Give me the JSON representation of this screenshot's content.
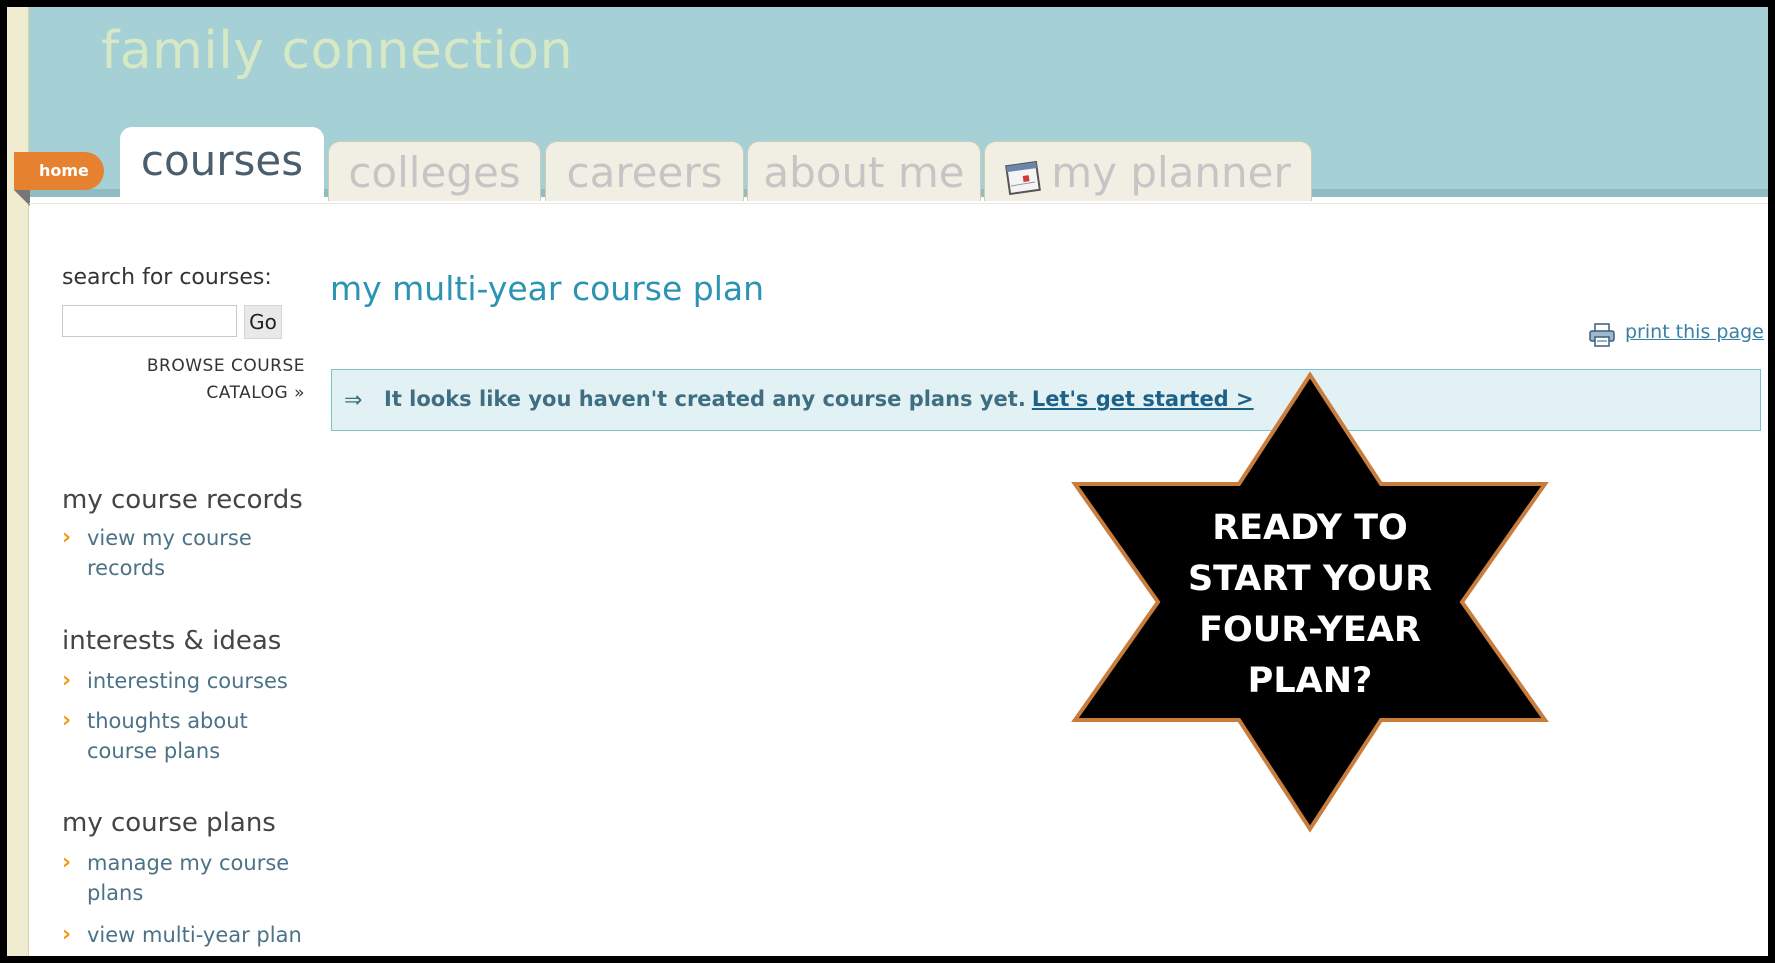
{
  "header": {
    "logo_text": "family connection",
    "home_label": "home",
    "tabs": [
      {
        "label": "courses",
        "active": true
      },
      {
        "label": "colleges",
        "active": false
      },
      {
        "label": "careers",
        "active": false
      },
      {
        "label": "about me",
        "active": false
      },
      {
        "label": "my planner",
        "active": false,
        "icon": "calendar-icon"
      }
    ]
  },
  "sidebar": {
    "search_label": "search for courses:",
    "search_value": "",
    "go_label": "Go",
    "browse_line1": "BROWSE COURSE",
    "browse_line2": "CATALOG »",
    "sections": [
      {
        "title": "my course records",
        "links": [
          "view my course records"
        ]
      },
      {
        "title": "interests & ideas",
        "links": [
          "interesting courses",
          "thoughts about course plans"
        ]
      },
      {
        "title": "my course plans",
        "links": [
          "manage my course plans",
          "view multi-year plan"
        ]
      }
    ]
  },
  "main": {
    "title": "my multi-year course plan",
    "print_label": "print this page",
    "notice_text": "It looks like you haven't created any course plans yet.",
    "notice_link": "Let's get started >"
  },
  "callout": {
    "line1": "READY TO",
    "line2": "START YOUR",
    "line3": "FOUR-YEAR",
    "line4": "PLAN?"
  },
  "colors": {
    "header_bg": "#a4d0d6",
    "home_tab": "#e6822f",
    "title_teal": "#2a94b2",
    "notice_bg": "#e2f1f3",
    "star_fill": "#000000",
    "star_stroke": "#c97d3c"
  }
}
